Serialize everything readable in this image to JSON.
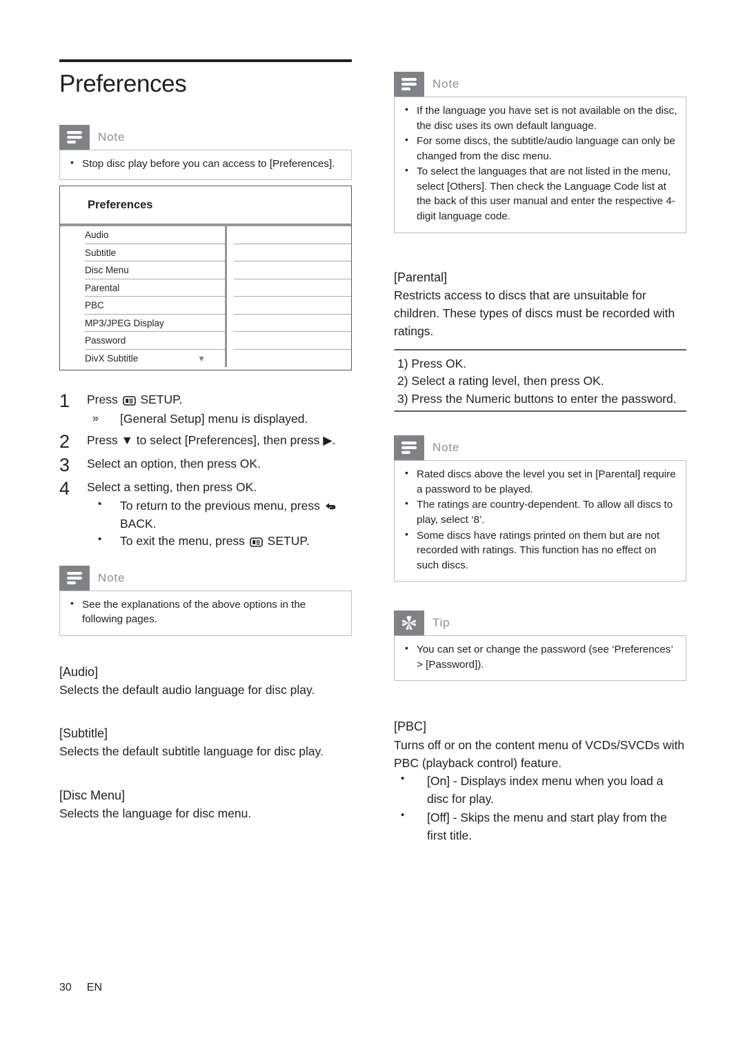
{
  "page": {
    "title": "Preferences",
    "footer_page_number": "30",
    "footer_language": "EN",
    "accent_gray": "#808285",
    "rule_dark": "#231f20",
    "panel_border": "#58595b"
  },
  "left": {
    "note_top": {
      "label": "Note",
      "icon": "note-lines-icon",
      "bullets": [
        "Stop disc play before you can access to [Preferences]."
      ]
    },
    "pref_menu": {
      "header": "Preferences",
      "scroll_arrow": "▼",
      "rows": [
        "Audio",
        "Subtitle",
        "Disc Menu",
        "Parental",
        "PBC",
        "MP3/JPEG Display",
        "Password",
        "DivX Subtitle"
      ]
    },
    "steps": [
      {
        "num": "1",
        "text_before_icon": "Press ",
        "icon": "setup-icon",
        "text_after_icon": " SETUP.",
        "sub_arrow": [
          "[General Setup] menu is displayed."
        ]
      },
      {
        "num": "2",
        "text": "Press ▼ to select [Preferences], then press ▶."
      },
      {
        "num": "3",
        "text": "Select an option, then press OK."
      },
      {
        "num": "4",
        "text": "Select a setting, then press OK.",
        "sub_dots": [
          {
            "before": "To return to the previous menu, press ",
            "icon": "back-arrow-icon",
            "after": " BACK."
          },
          {
            "before": "To exit the menu, press ",
            "icon": "setup-icon",
            "after": " SETUP."
          }
        ]
      }
    ],
    "note_bottom": {
      "label": "Note",
      "icon": "note-lines-icon",
      "bullets": [
        "See the explanations of the above options in the following pages."
      ]
    },
    "sections": [
      {
        "head": "[Audio]",
        "text": "Selects the default audio language for disc play."
      },
      {
        "head": "[Subtitle]",
        "text": "Selects the default subtitle language for disc play."
      },
      {
        "head": "[Disc Menu]",
        "text": "Selects the language for disc menu."
      }
    ]
  },
  "right": {
    "note_top": {
      "label": "Note",
      "icon": "note-lines-icon",
      "bullets": [
        "If the language you have set is not available on the disc, the disc uses its own default language.",
        "For some discs, the subtitle/audio language can only be changed from the disc menu.",
        "To select the languages that are not listed in the menu, select [Others]. Then check the Language Code list at the back of this user manual and enter the respective 4-digit language code."
      ]
    },
    "parental": {
      "head": "[Parental]",
      "text": "Restricts access to discs that are unsuitable for children. These types of discs must be recorded with ratings.",
      "procedure": [
        "1) Press OK.",
        "2) Select a rating level, then press OK.",
        "3) Press the Numeric buttons to enter the password."
      ]
    },
    "note_parental": {
      "label": "Note",
      "icon": "note-lines-icon",
      "bullets": [
        "Rated discs above the level you set in [Parental] require a password to be played.",
        "The ratings are country-dependent. To allow all discs to play, select ‘8’.",
        "Some discs have ratings printed on them but are not recorded with ratings. This function has no effect on such discs."
      ]
    },
    "tip": {
      "label": "Tip",
      "icon": "tip-star-icon",
      "bullets": [
        "You can set or change the password (see ‘Preferences’ > [Password])."
      ]
    },
    "pbc": {
      "head": "[PBC]",
      "text": "Turns off or on the content menu of VCDs/SVCDs with PBC (playback control) feature.",
      "options": [
        "[On] - Displays index menu when you load a disc for play.",
        "[Off] - Skips the menu and start play from the first title."
      ]
    }
  }
}
